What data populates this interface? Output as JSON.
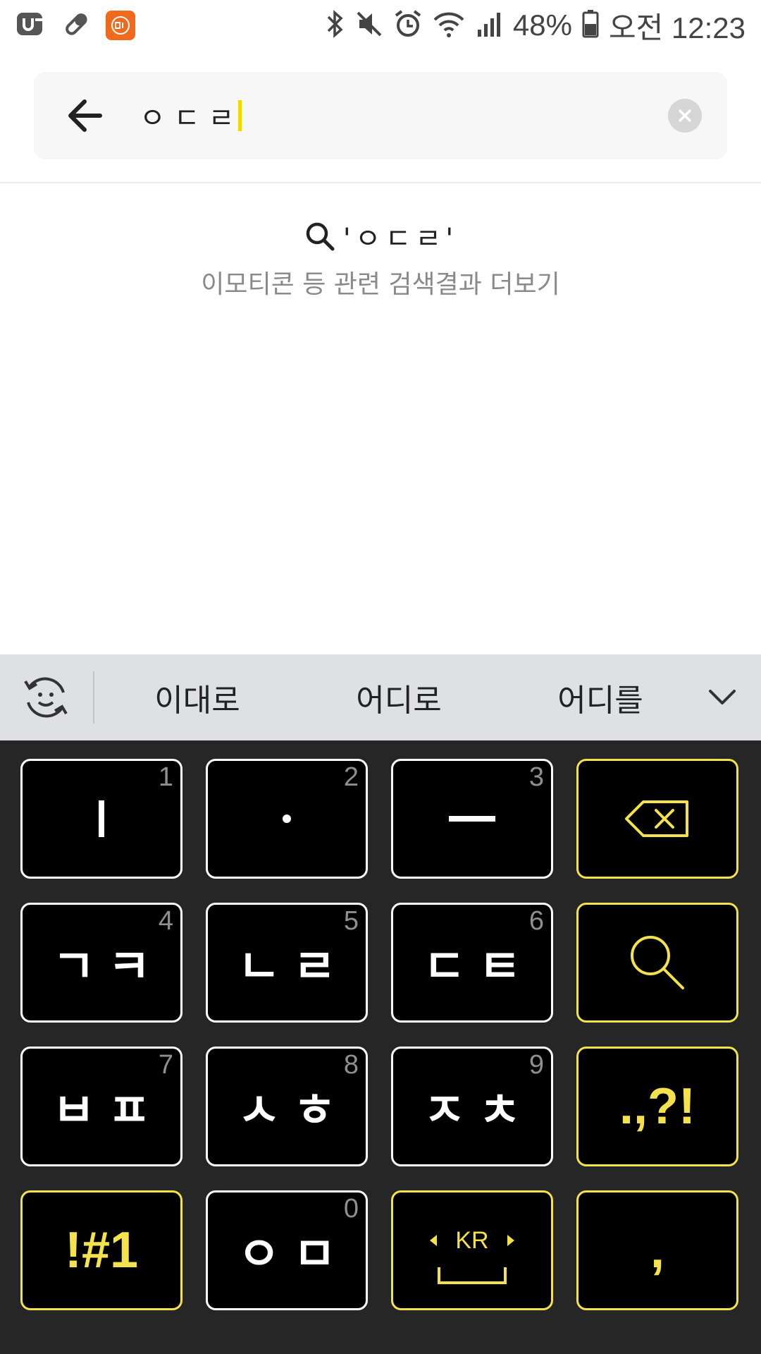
{
  "status_bar": {
    "battery": "48%",
    "time": "오전 12:23",
    "icons": [
      "u-plus-app-icon",
      "pill-icon",
      "mi-app-icon",
      "bluetooth-icon",
      "mute-icon",
      "alarm-icon",
      "wifi-icon",
      "signal-icon",
      "battery-icon"
    ]
  },
  "search": {
    "query": "ㅇㄷㄹ",
    "icons": {
      "back": "arrow-left-icon",
      "clear": "clear-circle-icon"
    }
  },
  "result": {
    "query_text": "'ㅇㄷㄹ'",
    "subtitle": "이모티콘 등 관련 검색결과 더보기"
  },
  "candidates": {
    "items": [
      "이대로",
      "어디로",
      "어디를"
    ]
  },
  "keyboard": {
    "accent_color": "#f3e24b",
    "keys": {
      "k1": {
        "num": "1"
      },
      "k2": {
        "num": "2"
      },
      "k3": {
        "num": "3"
      },
      "k4": {
        "label": "ㄱㅋ",
        "num": "4"
      },
      "k5": {
        "label": "ㄴㄹ",
        "num": "5"
      },
      "k6": {
        "label": "ㄷㅌ",
        "num": "6"
      },
      "k7": {
        "label": "ㅂㅍ",
        "num": "7"
      },
      "k8": {
        "label": "ㅅㅎ",
        "num": "8"
      },
      "k9": {
        "label": "ㅈㅊ",
        "num": "9"
      },
      "k0": {
        "label": "ㅇㅁ",
        "num": "0"
      },
      "punct": {
        "label": ".,?!"
      },
      "symbols": {
        "label": "!#1"
      },
      "space": {
        "lang": "KR"
      },
      "comma": {
        "label": ","
      }
    }
  }
}
